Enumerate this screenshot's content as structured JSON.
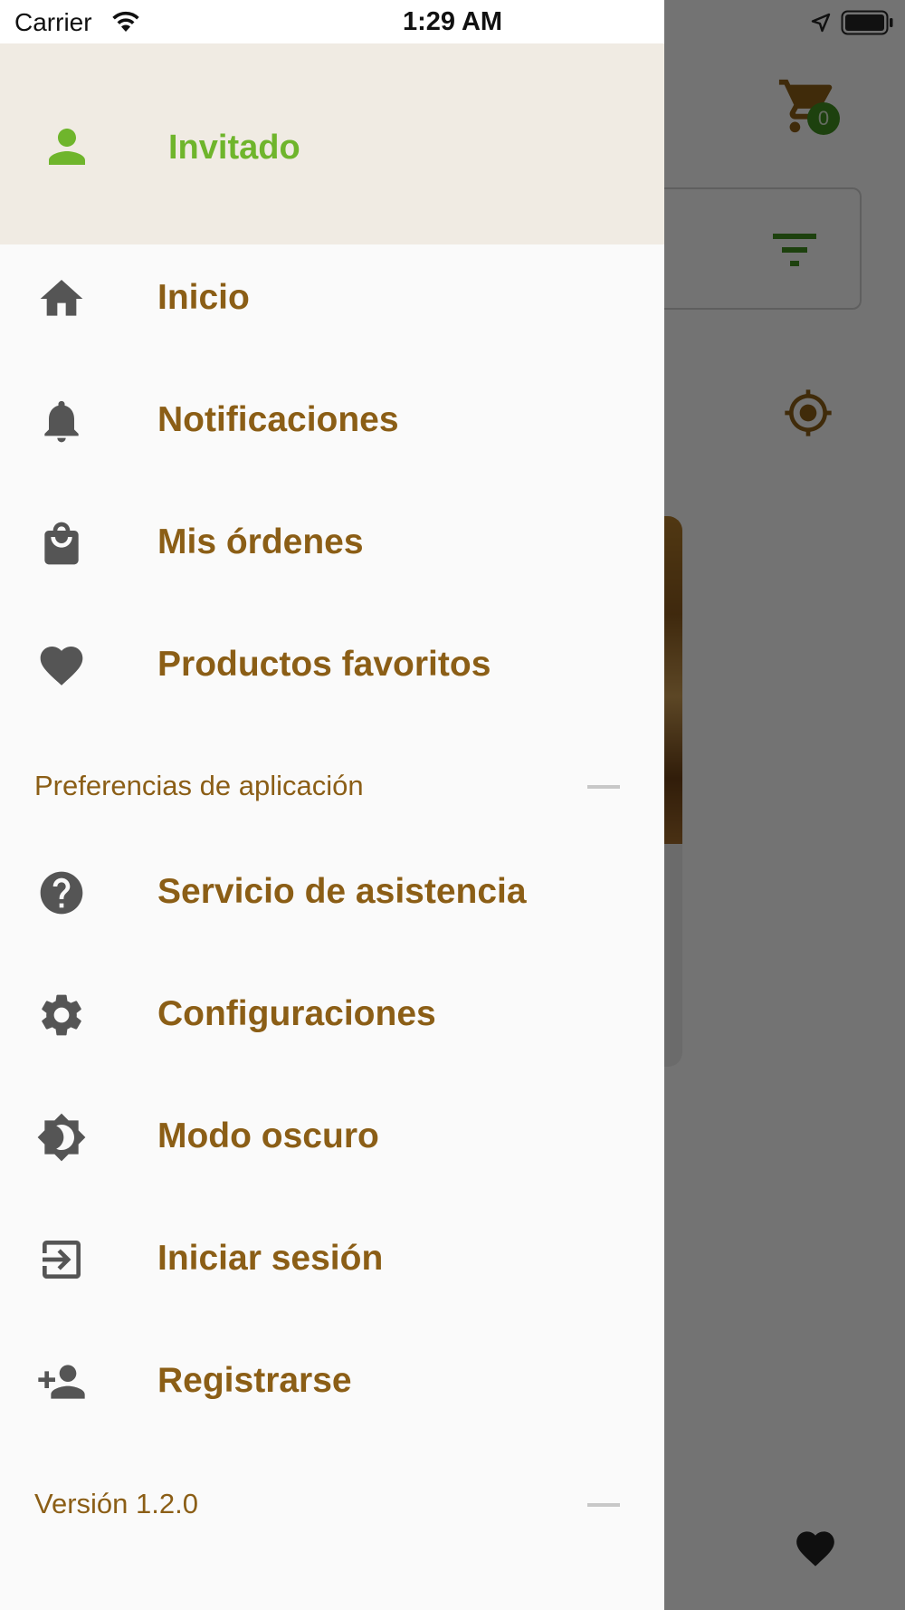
{
  "status_bar": {
    "carrier": "Carrier",
    "time": "1:29 AM"
  },
  "drawer": {
    "header": {
      "user_name": "Invitado",
      "avatar_icon": "person-icon"
    },
    "items": [
      {
        "label": "Inicio",
        "icon": "home-icon"
      },
      {
        "label": "Notificaciones",
        "icon": "bell-icon"
      },
      {
        "label": "Mis órdenes",
        "icon": "shopping-bag-icon"
      },
      {
        "label": "Productos favoritos",
        "icon": "heart-icon"
      }
    ],
    "preferences_section": "Preferencias de aplicación",
    "preferences_items": [
      {
        "label": "Servicio de asistencia",
        "icon": "help-icon"
      },
      {
        "label": "Configuraciones",
        "icon": "gear-icon"
      },
      {
        "label": "Modo oscuro",
        "icon": "brightness-icon"
      },
      {
        "label": "Iniciar sesión",
        "icon": "login-icon"
      },
      {
        "label": "Registrarse",
        "icon": "person-add-icon"
      }
    ],
    "version": "Versión 1.2.0"
  },
  "background": {
    "cart_count": "0"
  },
  "colors": {
    "accent_text": "#8b5e16",
    "user_name": "#6fb52c",
    "header_bg": "#f0ebe3",
    "icon": "#555555",
    "cart_badge": "#3f8f1f"
  }
}
